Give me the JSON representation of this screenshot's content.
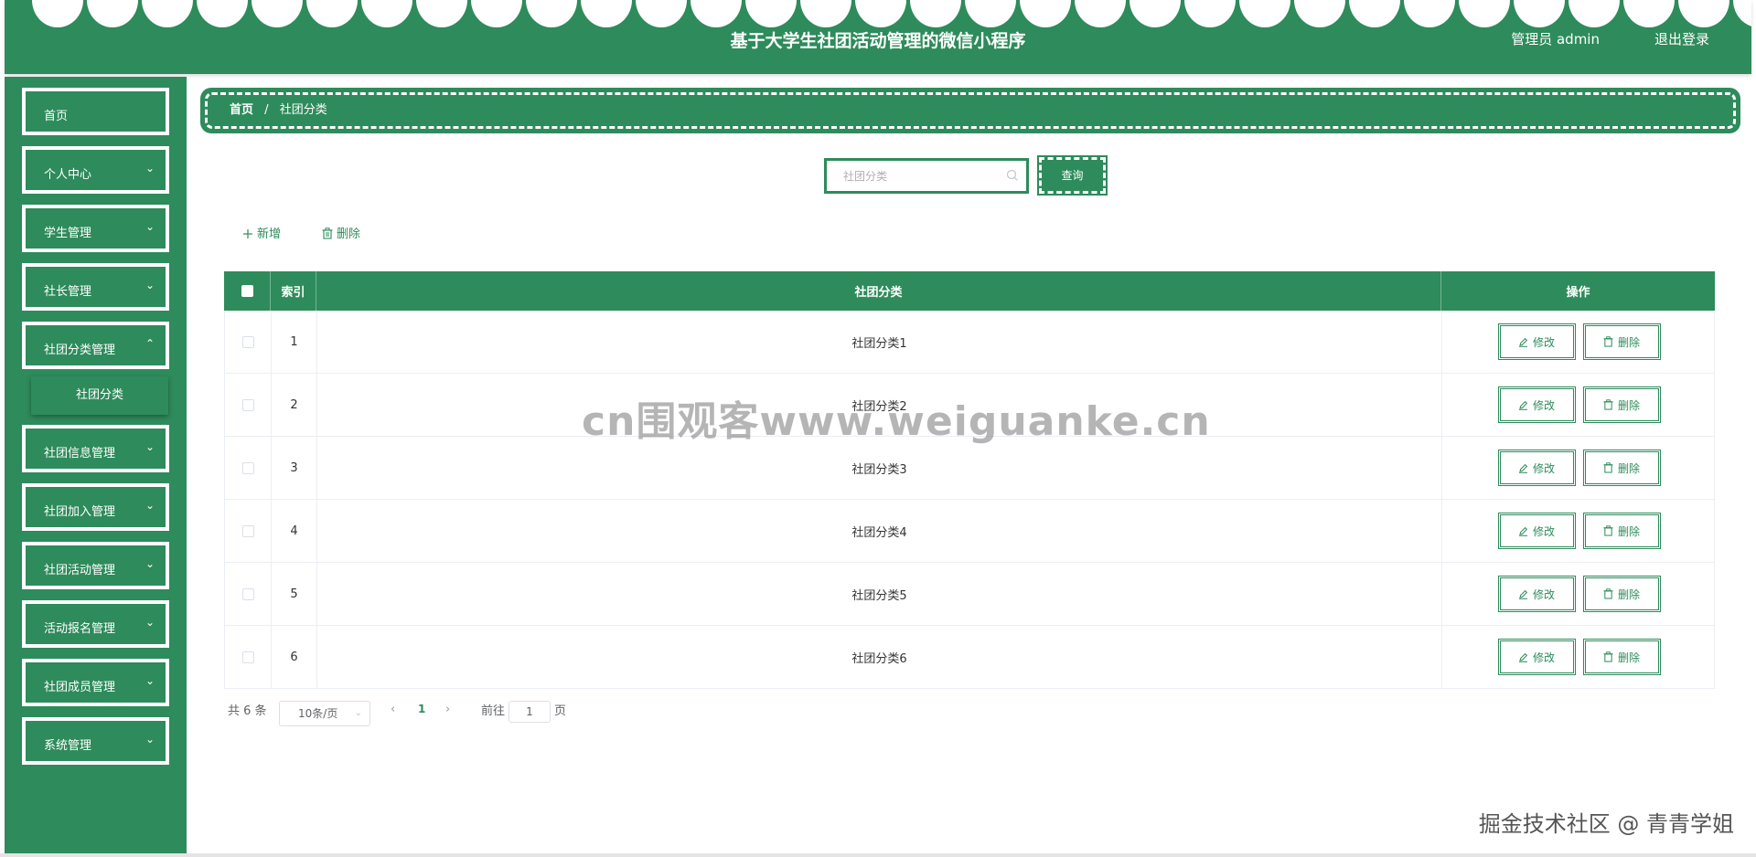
{
  "header": {
    "title": "基于大学生社团活动管理的微信小程序",
    "user": "管理员 admin",
    "logout": "退出登录",
    "bg_color": "#2e8b5b"
  },
  "sidebar": {
    "items": [
      {
        "label": "首页",
        "has_arrow": false
      },
      {
        "label": "个人中心",
        "has_arrow": true
      },
      {
        "label": "学生管理",
        "has_arrow": true
      },
      {
        "label": "社长管理",
        "has_arrow": true
      },
      {
        "label": "社团分类管理",
        "has_arrow": true,
        "expanded": true
      },
      {
        "label": "社团信息管理",
        "has_arrow": true
      },
      {
        "label": "社团加入管理",
        "has_arrow": true
      },
      {
        "label": "社团活动管理",
        "has_arrow": true
      },
      {
        "label": "活动报名管理",
        "has_arrow": true
      },
      {
        "label": "社团成员管理",
        "has_arrow": true
      },
      {
        "label": "系统管理",
        "has_arrow": true
      }
    ],
    "submenu": {
      "label": "社团分类",
      "active": true
    },
    "arrow_icon": "chevron-down-icon"
  },
  "breadcrumb": {
    "home": "首页",
    "separator": "/",
    "current": "社团分类"
  },
  "search": {
    "placeholder": "社团分类",
    "value": "",
    "button": "查询",
    "icon": "search-icon"
  },
  "actions": {
    "add": "新增",
    "delete": "删除"
  },
  "table": {
    "headers": {
      "index": "索引",
      "name": "社团分类",
      "ops": "操作"
    },
    "rows": [
      {
        "index": "1",
        "name": "社团分类1"
      },
      {
        "index": "2",
        "name": "社团分类2"
      },
      {
        "index": "3",
        "name": "社团分类3"
      },
      {
        "index": "4",
        "name": "社团分类4"
      },
      {
        "index": "5",
        "name": "社团分类5"
      },
      {
        "index": "6",
        "name": "社团分类6"
      }
    ],
    "row_ops": {
      "edit": "修改",
      "delete": "删除"
    }
  },
  "pagination": {
    "total": "共 6 条",
    "page_size": "10条/页",
    "current_page": "1",
    "goto_label": "前往",
    "goto_value": "1",
    "page_suffix": "页"
  },
  "watermarks": {
    "center": "cn围观客www.weiguanke.cn",
    "corner": "掘金技术社区 @ 青青学姐"
  }
}
